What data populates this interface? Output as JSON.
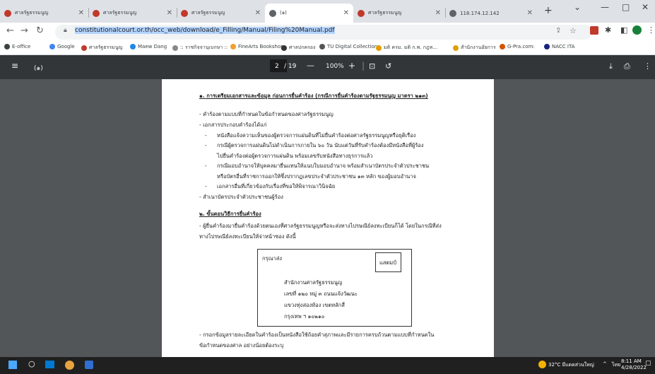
{
  "browser": {
    "tabs": [
      {
        "title": "ศาลรัฐธรรมนูญ",
        "favicon_color": "#c0392b",
        "active": false
      },
      {
        "title": "ศาลรัฐธรรมนูญ",
        "favicon_color": "#c0392b",
        "active": false
      },
      {
        "title": "ศาลรัฐธรรมนูญ",
        "favicon_color": "#c0392b",
        "active": false
      },
      {
        "title": "(๑)",
        "favicon_color": "#5f6368",
        "active": true
      },
      {
        "title": "ศาลรัฐธรรมนูญ",
        "favicon_color": "#c0392b",
        "active": false
      },
      {
        "title": "118.174.12.142",
        "favicon_color": "#5f6368",
        "active": false
      }
    ],
    "new_tab_label": "+",
    "url": "constitutionalcourt.or.th/occ_web/download/e_Filling/Manual/Filing%20Manual.pdf",
    "bookmarks": [
      "E-office",
      "Google",
      "ศาลรัฐธรรมนูญ",
      "Maew Dang",
      ":: ราชกิจจานุเบกษา ::",
      "FineArts Bookshop",
      "ศาลปกครอง",
      "TU Digital Collections",
      "มติ ครม. มติ ก.พ. กฎห...",
      "สำนักงานอัยการ",
      "G-Pra.com:",
      "NACC ITA"
    ]
  },
  "pdf_viewer": {
    "title": "(๑)",
    "current_page": "2",
    "total_pages": "/ 19",
    "zoom": "100%"
  },
  "document": {
    "section1_title": "๑. การเตรียมเอกสารและข้อมูล ก่อนการยื่นคำร้อง (กรณีการยื่นคำร้องตามรัฐธรรมนูญ มาตรา ๒๑๓)",
    "lines1": [
      "- คำร้องตามแบบที่กำหนดในข้อกำหนดของศาลรัฐธรรมนูญ",
      "- เอกสารประกอบคำร้องได้แก่",
      "หนังสือแจ้งความเห็นของผู้ตรวจการแผ่นดินที่ไม่ยื่นคำร้องต่อศาลรัฐธรรมนูญหรือยุติเรื่อง",
      "กรณีผู้ตรวจการแผ่นดินไม่ดำเนินการภายใน ๖๐ วัน นับแต่วันที่รับคำร้องต้องมีหนังสือที่ผู้ร้อง",
      "ไปยื่นคำร้องต่อผู้ตรวจการแผ่นดิน พร้อมเลขรับหนังสือทางธุรการแล้ว",
      "กรณีมอบอำนาจให้บุคคลมายื่นแทนให้แนบใบมอบอำนาจ พร้อมสำเนาบัตรประจำตัวประชาชน",
      "หรือบัตรอื่นที่ราชการออกให้ซึ่งปรากฏเลขประจำตัวประชาชน ๑๓ หลัก ของผู้มอบอำนาจ",
      "เอกสารอื่นที่เกี่ยวข้องกับเรื่องที่ขอให้พิจารณาวินิจฉัย",
      "- สำเนาบัตรประจำตัวประชาชนผู้ร้อง"
    ],
    "section2_title": "๒. ขั้นตอนวิธีการยื่นคำร้อง",
    "lines2": [
      "- ผู้ยื่นคำร้องมายื่นคำร้องด้วยตนเองที่ศาลรัฐธรรมนูญหรือจะส่งทางไปรษณีย์ลงทะเบียนก็ได้ โดยในกรณีที่ส่ง",
      "ทางไปรษณีย์ลงทะเบียนให้จ่าหน้าซอง ดังนี้"
    ],
    "envelope": {
      "sender": "กรุณาส่ง",
      "stamp": "แสตมป์",
      "address": [
        "สำนักงานศาลรัฐธรรมนูญ",
        "เลขที่ ๑๒๐ หมู่ ๓ ถนนแจ้งวัฒนะ",
        "แขวงทุ่งสองห้อง เขตหลักสี่",
        "กรุงเทพ ฯ ๑๐๒๑๐"
      ]
    },
    "lines3": [
      "- กรอกข้อมูลรายละเอียดในคำร้องเป็นหนังสือใช้ถ้อยคำสุภาพและมีรายการครบถ้วนตามแบบที่กำหนดใน",
      "ข้อกำหนดของศาล อย่างน้อยต้องระบุ"
    ]
  },
  "taskbar": {
    "weather": "32°C มีแดดส่วนใหญ่",
    "lang": "ไทย",
    "time": "8:11 AM",
    "date": "4/28/2022"
  },
  "colors": {
    "pdf_bg": "#525659",
    "pdf_toolbar": "#323639",
    "accent": "#1a73e8"
  }
}
